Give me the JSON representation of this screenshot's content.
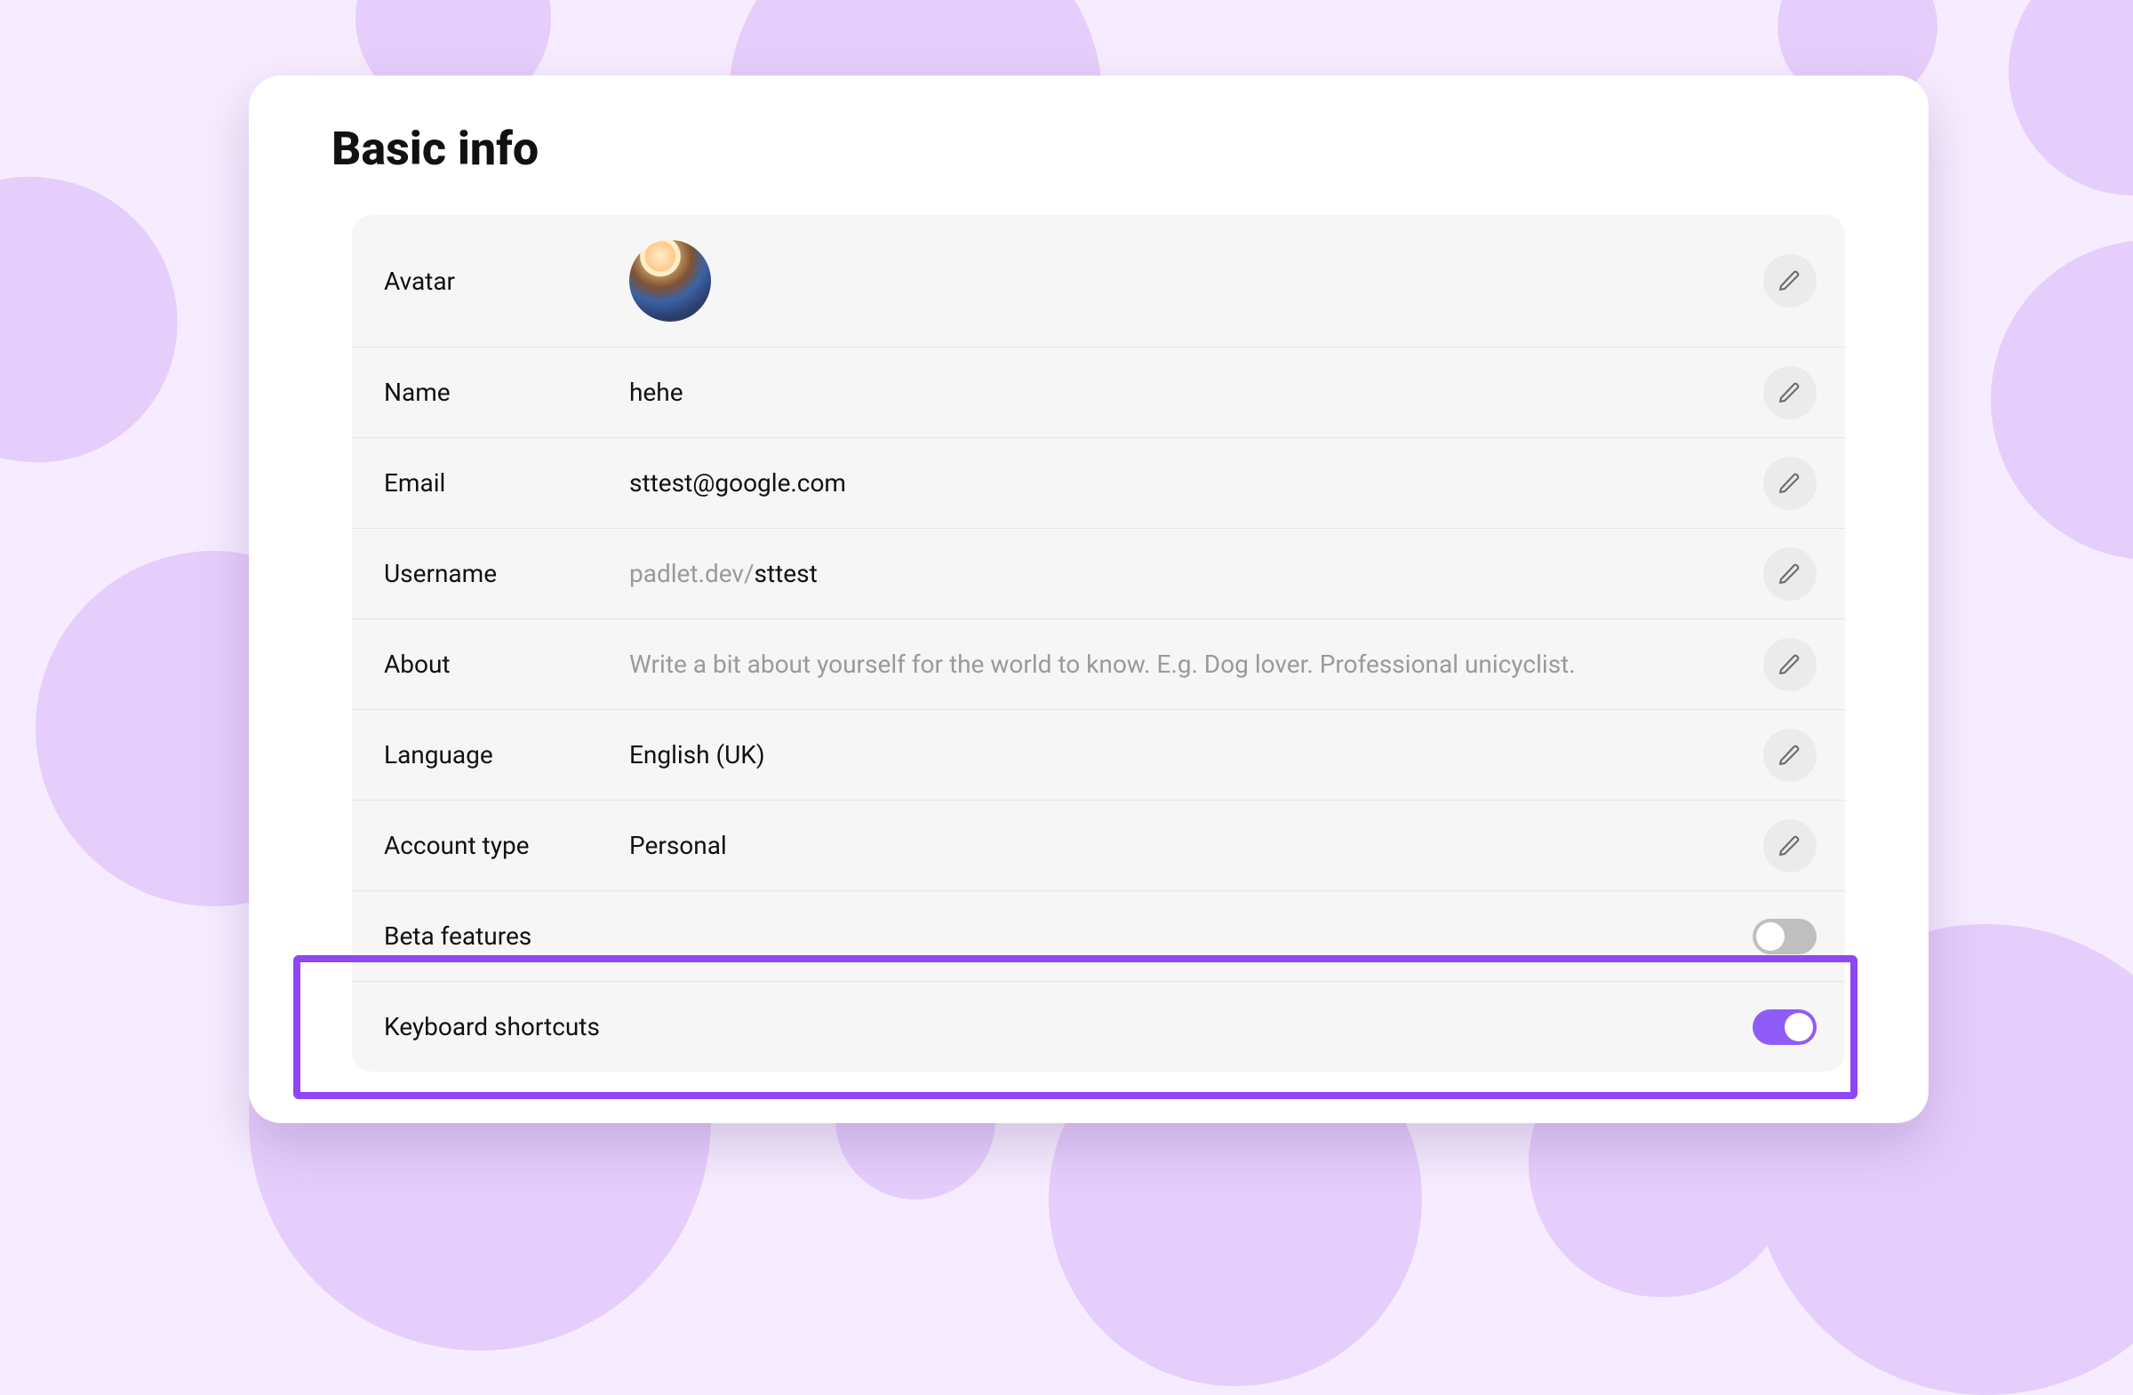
{
  "title": "Basic info",
  "colors": {
    "accent": "#8f46f4",
    "toggleOn": "#8f5cf7",
    "panel": "#f6f6f6",
    "background": "#f7ecff",
    "blob": "#e6cefc"
  },
  "rows": {
    "avatar": {
      "label": "Avatar"
    },
    "name": {
      "label": "Name",
      "value": "hehe"
    },
    "email": {
      "label": "Email",
      "value": "sttest@google.com"
    },
    "username": {
      "label": "Username",
      "prefix": "padlet.dev/",
      "value": "sttest"
    },
    "about": {
      "label": "About",
      "placeholder": "Write a bit about yourself for the world to know. E.g. Dog lover. Professional unicyclist."
    },
    "language": {
      "label": "Language",
      "value": "English (UK)"
    },
    "account": {
      "label": "Account type",
      "value": "Personal"
    },
    "beta": {
      "label": "Beta features",
      "on": false
    },
    "keyboard": {
      "label": "Keyboard shortcuts",
      "on": true
    }
  },
  "icons": {
    "edit": "pencil-icon"
  }
}
